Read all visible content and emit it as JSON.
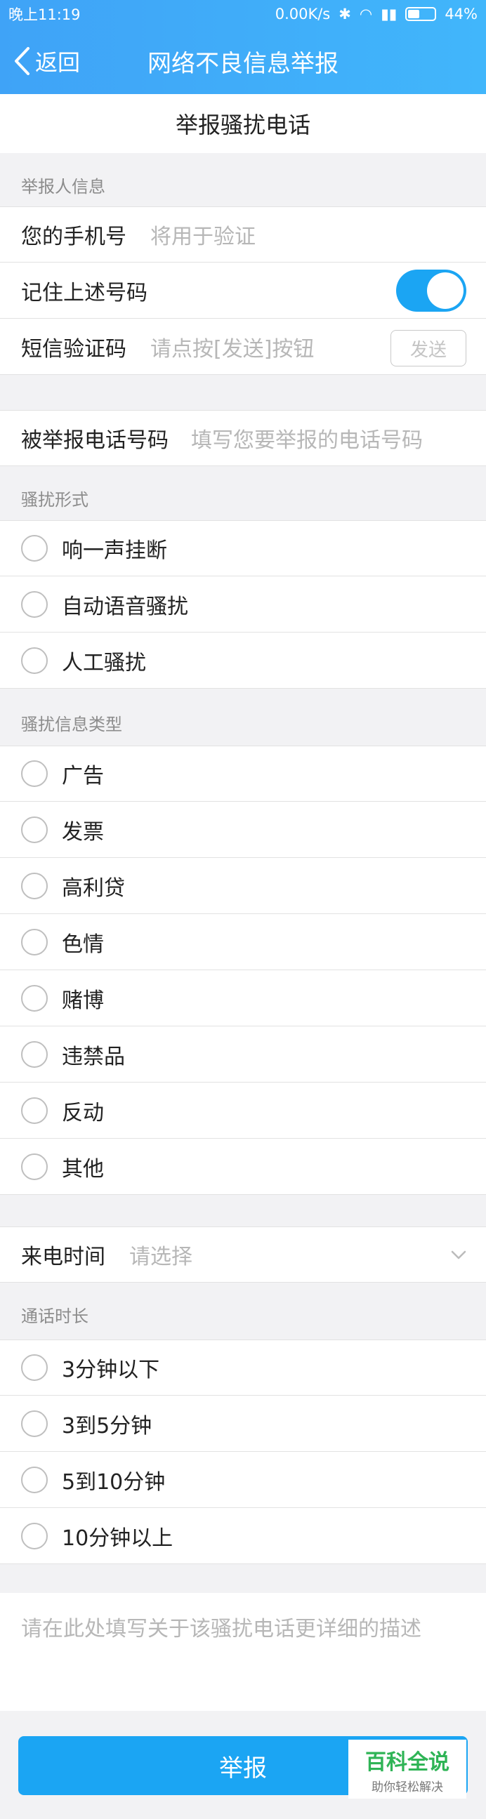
{
  "status_bar": {
    "time": "晚上11:19",
    "speed": "0.00K/s",
    "battery": "44%"
  },
  "nav": {
    "back_label": "返回",
    "title": "网络不良信息举报"
  },
  "page_heading": "举报骚扰电话",
  "reporter_section": {
    "label": "举报人信息",
    "phone_label": "您的手机号",
    "phone_placeholder": "将用于验证",
    "remember_label": "记住上述号码",
    "remember_on": true,
    "sms_label": "短信验证码",
    "sms_placeholder": "请点按[发送]按钮",
    "send_label": "发送"
  },
  "reported_number": {
    "label": "被举报电话号码",
    "placeholder": "填写您要举报的电话号码"
  },
  "harass_form": {
    "label": "骚扰形式",
    "options": [
      "响一声挂断",
      "自动语音骚扰",
      "人工骚扰"
    ]
  },
  "harass_type": {
    "label": "骚扰信息类型",
    "options": [
      "广告",
      "发票",
      "高利贷",
      "色情",
      "赌博",
      "违禁品",
      "反动",
      "其他"
    ]
  },
  "call_time": {
    "label": "来电时间",
    "placeholder": "请选择"
  },
  "call_duration": {
    "label": "通话时长",
    "options": [
      "3分钟以下",
      "3到5分钟",
      "5到10分钟",
      "10分钟以上"
    ]
  },
  "description_placeholder": "请在此处填写关于该骚扰电话更详细的描述",
  "submit_label": "举报",
  "watermark": {
    "title": "百科全说",
    "subtitle": "助你轻松解决"
  },
  "colors": {
    "nav": "#3fa3f7",
    "accent": "#1ba5f3",
    "watermark": "#2fb456"
  }
}
